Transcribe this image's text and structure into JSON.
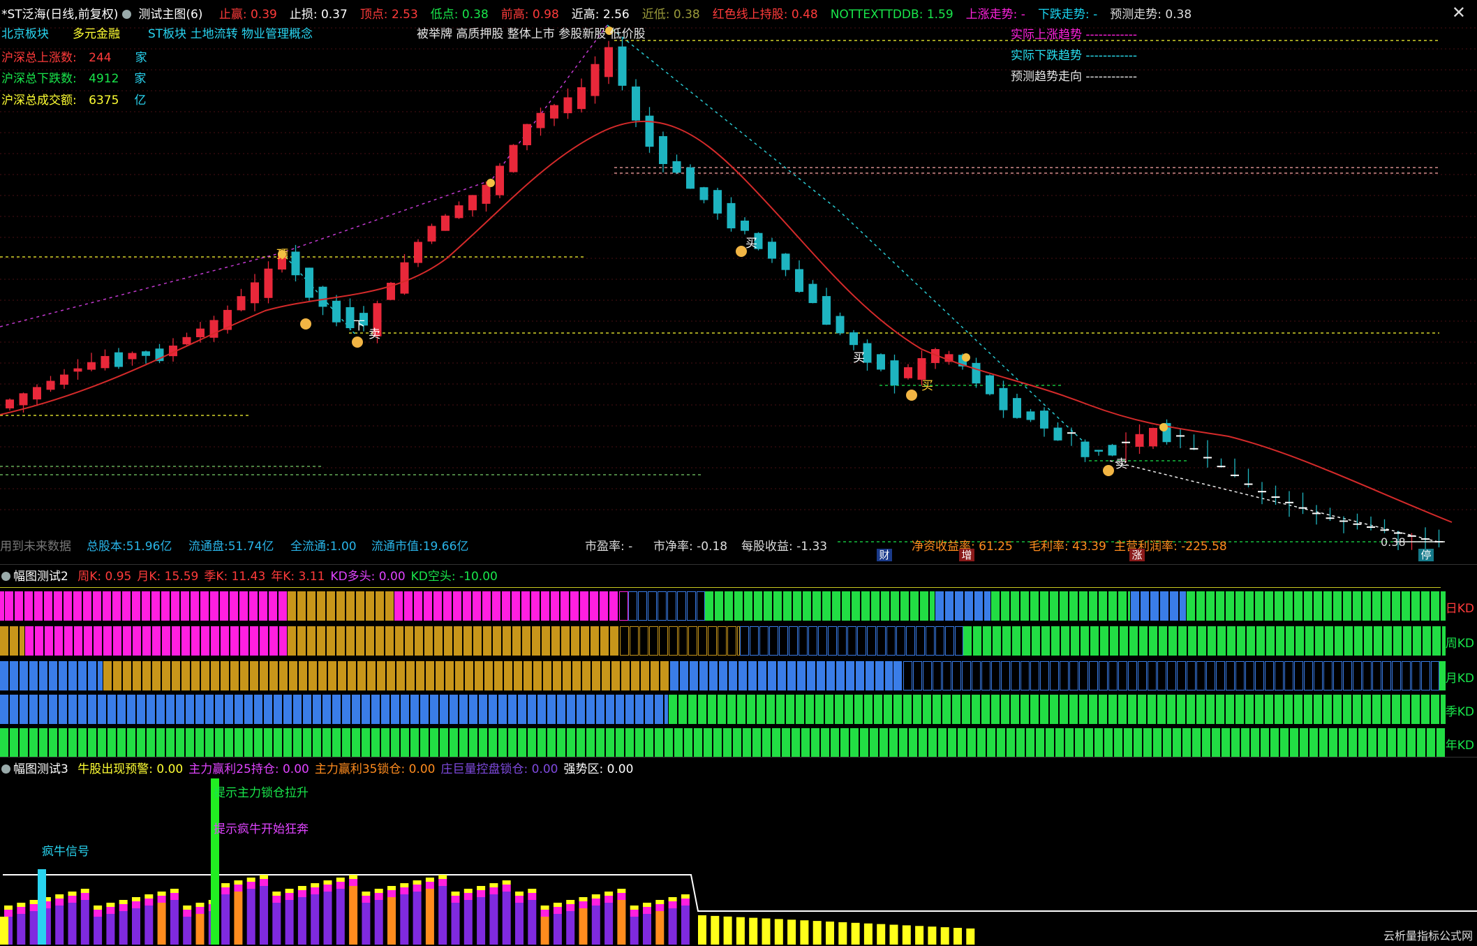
{
  "colors": {
    "up": "#e8283a",
    "down": "#1eb4c0",
    "ma": "#d42a2a",
    "magenta": "#ff1fe0",
    "green": "#22dd44",
    "blue": "#3a7de8",
    "gold": "#c8961a",
    "yellow": "#ffff1a",
    "purple": "#7f2adf",
    "orange": "#ff8c1e",
    "cyan": "#29d4e8"
  },
  "header": {
    "stock": "*ST泛海(日线,前复权)",
    "formula": "测试主图(6)",
    "items": [
      {
        "label": "止赢:",
        "value": "0.39",
        "color": "#ff3b3b"
      },
      {
        "label": "止损:",
        "value": "0.37",
        "color": "#ffffff"
      },
      {
        "label": "顶点:",
        "value": "2.53",
        "color": "#ff3b3b"
      },
      {
        "label": "低点:",
        "value": "0.38",
        "color": "#19e64b"
      },
      {
        "label": "前高:",
        "value": "0.98",
        "color": "#ff3b3b"
      },
      {
        "label": "近高:",
        "value": "2.56",
        "color": "#ffffff"
      },
      {
        "label": "近低:",
        "value": "0.38",
        "color": "#9a9a3a"
      },
      {
        "label": "红色线上持股:",
        "value": "0.48",
        "color": "#ff3b3b"
      },
      {
        "label": "NOTTEXTTDDB:",
        "value": "1.59",
        "color": "#19e64b"
      },
      {
        "label": "上涨走势:",
        "value": "-",
        "color": "#ff22dd"
      },
      {
        "label": "下跌走势:",
        "value": "-",
        "color": "#19d4f0"
      },
      {
        "label": "预测走势:",
        "value": "0.38",
        "color": "#dddddd"
      }
    ]
  },
  "sectors": [
    "北京板块",
    "多元金融",
    "ST板块 土地流转 物业管理概念"
  ],
  "concepts": "被举牌 高质押股 整体上市 参股新股 低价股",
  "market": [
    {
      "label": "沪深总上涨数:",
      "value": "244",
      "unit": "家"
    },
    {
      "label": "沪深总下跌数:",
      "value": "4912",
      "unit": "家"
    },
    {
      "label": "沪深总成交额:",
      "value": "6375",
      "unit": "亿"
    }
  ],
  "trend_legend": [
    {
      "label": "实际上涨趋势",
      "line": "------------"
    },
    {
      "label": "实际下跌趋势",
      "line": "------------"
    },
    {
      "label": "预测趋势走向",
      "line": "------------"
    }
  ],
  "chart_labels": {
    "top": "顶",
    "buy": "买",
    "sell": "卖",
    "down": "下"
  },
  "footer_main": {
    "future": "用到未来数据",
    "total_shares": "总股本:51.96亿",
    "float": "流通盘:51.74亿",
    "full_float": "全流通:1.00",
    "float_value": "流通市值:19.66亿",
    "pe": "市盈率: -",
    "pb": "市净率: -0.18",
    "eps": "每股收益: -1.33",
    "roe": "净资收益率: 61.25",
    "gross": "毛利率: 43.39",
    "margin": "主营利润率: -225.58",
    "last": "0.38"
  },
  "badges": [
    "财",
    "增",
    "涨",
    "停"
  ],
  "pane2": {
    "title": "幅图测试2",
    "items": [
      {
        "label": "周K:",
        "value": "0.95",
        "color": "#ff3b3b"
      },
      {
        "label": "月K:",
        "value": "15.59",
        "color": "#ff3b3b"
      },
      {
        "label": "季K:",
        "value": "11.43",
        "color": "#ff3b3b"
      },
      {
        "label": "年K:",
        "value": "3.11",
        "color": "#ff3b3b"
      },
      {
        "label": "KD多头:",
        "value": "0.00",
        "color": "#e044ff"
      },
      {
        "label": "KD空头:",
        "value": "-10.00",
        "color": "#19e64b"
      }
    ],
    "row_labels": [
      "日KD",
      "周KD",
      "月KD",
      "季KD",
      "年KD"
    ]
  },
  "pane3": {
    "title": "幅图测试3",
    "items": [
      {
        "label": "牛股出现预警:",
        "value": "0.00",
        "color": "#ffff33"
      },
      {
        "label": "主力赢利25持仓:",
        "value": "0.00",
        "color": "#e044ff"
      },
      {
        "label": "主力赢利35锁仓:",
        "value": "0.00",
        "color": "#ff8c1e"
      },
      {
        "label": "庄巨量控盘锁仓:",
        "value": "0.00",
        "color": "#7f4adf"
      },
      {
        "label": "强势区:",
        "value": "0.00",
        "color": "#ffffff"
      }
    ],
    "annot1": "提示主力锁仓拉升",
    "annot2": "提示疯牛开始狂奔",
    "annot3": "疯牛信号"
  },
  "watermark": "云析量指标公式网"
}
